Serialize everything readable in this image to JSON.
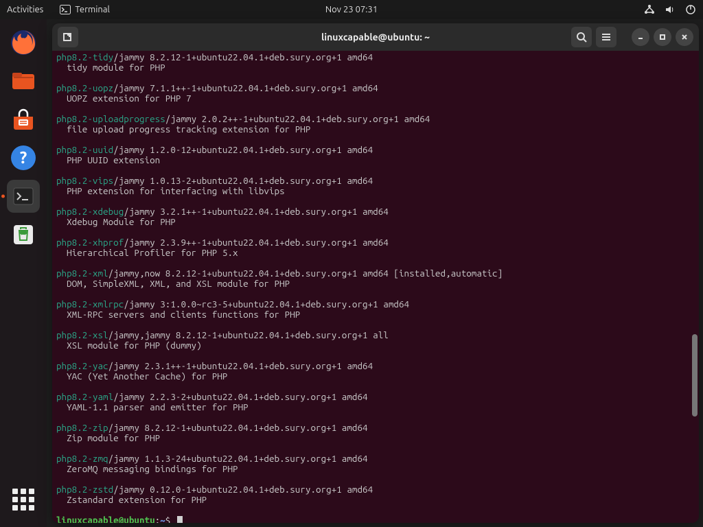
{
  "topbar": {
    "activities": "Activities",
    "app_label": "Terminal",
    "clock": "Nov 23  07:31"
  },
  "window": {
    "title": "linuxcapable@ubuntu: ~"
  },
  "prompt": {
    "user_host": "linuxcapable@ubuntu",
    "path": "~",
    "symbol": "$"
  },
  "packages": [
    {
      "name": "php8.2-tidy",
      "details": "/jammy 8.2.12-1+ubuntu22.04.1+deb.sury.org+1 amd64",
      "desc": "tidy module for PHP"
    },
    {
      "name": "php8.2-uopz",
      "details": "/jammy 7.1.1++-1+ubuntu22.04.1+deb.sury.org+1 amd64",
      "desc": "UOPZ extension for PHP 7"
    },
    {
      "name": "php8.2-uploadprogress",
      "details": "/jammy 2.0.2++-1+ubuntu22.04.1+deb.sury.org+1 amd64",
      "desc": "file upload progress tracking extension for PHP"
    },
    {
      "name": "php8.2-uuid",
      "details": "/jammy 1.2.0-12+ubuntu22.04.1+deb.sury.org+1 amd64",
      "desc": "PHP UUID extension"
    },
    {
      "name": "php8.2-vips",
      "details": "/jammy 1.0.13-2+ubuntu22.04.1+deb.sury.org+1 amd64",
      "desc": "PHP extension for interfacing with libvips"
    },
    {
      "name": "php8.2-xdebug",
      "details": "/jammy 3.2.1++-1+ubuntu22.04.1+deb.sury.org+1 amd64",
      "desc": "Xdebug Module for PHP"
    },
    {
      "name": "php8.2-xhprof",
      "details": "/jammy 2.3.9++-1+ubuntu22.04.1+deb.sury.org+1 amd64",
      "desc": "Hierarchical Profiler for PHP 5.x"
    },
    {
      "name": "php8.2-xml",
      "details": "/jammy,now 8.2.12-1+ubuntu22.04.1+deb.sury.org+1 amd64 [installed,automatic]",
      "desc": "DOM, SimpleXML, XML, and XSL module for PHP"
    },
    {
      "name": "php8.2-xmlrpc",
      "details": "/jammy 3:1.0.0~rc3-5+ubuntu22.04.1+deb.sury.org+1 amd64",
      "desc": "XML-RPC servers and clients functions for PHP"
    },
    {
      "name": "php8.2-xsl",
      "details": "/jammy,jammy 8.2.12-1+ubuntu22.04.1+deb.sury.org+1 all",
      "desc": "XSL module for PHP (dummy)"
    },
    {
      "name": "php8.2-yac",
      "details": "/jammy 2.3.1++-1+ubuntu22.04.1+deb.sury.org+1 amd64",
      "desc": "YAC (Yet Another Cache) for PHP"
    },
    {
      "name": "php8.2-yaml",
      "details": "/jammy 2.2.3-2+ubuntu22.04.1+deb.sury.org+1 amd64",
      "desc": "YAML-1.1 parser and emitter for PHP"
    },
    {
      "name": "php8.2-zip",
      "details": "/jammy 8.2.12-1+ubuntu22.04.1+deb.sury.org+1 amd64",
      "desc": "Zip module for PHP"
    },
    {
      "name": "php8.2-zmq",
      "details": "/jammy 1.1.3-24+ubuntu22.04.1+deb.sury.org+1 amd64",
      "desc": "ZeroMQ messaging bindings for PHP"
    },
    {
      "name": "php8.2-zstd",
      "details": "/jammy 0.12.0-1+ubuntu22.04.1+deb.sury.org+1 amd64",
      "desc": "Zstandard extension for PHP"
    }
  ]
}
